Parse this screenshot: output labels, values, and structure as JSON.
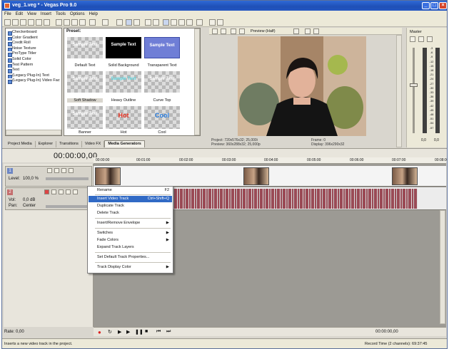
{
  "window": {
    "title": "veg_1.veg * - Vegas Pro 9.0",
    "controls": [
      "_",
      "□",
      "×"
    ]
  },
  "menu": [
    "File",
    "Edit",
    "View",
    "Insert",
    "Tools",
    "Options",
    "Help"
  ],
  "media_generators": {
    "items": [
      "Checkerboard",
      "Color Gradient",
      "Credit Roll",
      "Noise Texture",
      "ProType Titler",
      "Solid Color",
      "Test Pattern",
      "Text",
      "(Legacy Plug-In) Text",
      "(Legacy Plug-In) Video Factory"
    ],
    "selected": "Text"
  },
  "presets": {
    "label": "Preset:",
    "items": [
      {
        "name": "Default Text",
        "sample": "Sample Text",
        "style": "checker"
      },
      {
        "name": "Solid Background",
        "sample": "Sample Text",
        "style": "black"
      },
      {
        "name": "Transparent Text",
        "sample": "Sample Text",
        "style": "blue"
      },
      {
        "name": "Soft Shadow",
        "sample": "Sample Text",
        "style": "checker"
      },
      {
        "name": "Heavy Outline",
        "sample": "Sample Text",
        "style": "checker-outline"
      },
      {
        "name": "Curve Top",
        "sample": "Sample Text",
        "style": "checker"
      },
      {
        "name": "Banner",
        "sample": "Sample Text",
        "style": "checker"
      },
      {
        "name": "Hot",
        "sample": "Hot",
        "style": "hot"
      },
      {
        "name": "Cool",
        "sample": "Cool",
        "style": "cool"
      }
    ]
  },
  "tabs": [
    "Project Media",
    "Explorer",
    "Transitions",
    "Video FX",
    "Media Generators"
  ],
  "active_tab": "Media Generators",
  "preview": {
    "mode": "Preview (Half)",
    "project": "Project:  720x576x32; 25,000i",
    "preview_res": "Preview:  360x288x32; 25,000p",
    "frame": "Frame:     0",
    "display": "Display:   396x290x32"
  },
  "master": {
    "label": "Master",
    "levels": [
      "-3",
      "-6",
      "-9",
      "-12",
      "-15",
      "-18",
      "-21",
      "-24",
      "-27",
      "-30",
      "-33",
      "-36",
      "-39",
      "-42",
      "-45",
      "-48",
      "-51",
      "-54",
      "-57"
    ],
    "values": [
      "0,0",
      "0,0"
    ]
  },
  "timeline": {
    "timecode": "00:00:00,00",
    "ruler": [
      "00:00:00",
      "00:01:00",
      "00:02:00",
      "00:03:00",
      "00:04:00",
      "00:05:00",
      "00:06:00",
      "00:07:00",
      "00:08:00"
    ],
    "tracks": [
      {
        "number": "1",
        "type": "video",
        "level_label": "Level:",
        "level_value": "100,0 %"
      },
      {
        "number": "2",
        "type": "audio",
        "vol_label": "Vol:",
        "vol_value": "0,0 dB",
        "pan_label": "Pan:",
        "pan_value": "Center"
      }
    ],
    "rate": "Rate: 0,00",
    "end_time": "00:00:00,00"
  },
  "context_menu": {
    "items": [
      {
        "label": "Rename",
        "shortcut": "F2"
      },
      {
        "label": "Insert Video Track",
        "shortcut": "Ctrl+Shift+Q",
        "highlighted": true
      },
      {
        "label": "Duplicate Track"
      },
      {
        "label": "Delete Track"
      },
      {
        "label": "Insert/Remove Envelope",
        "submenu": true
      },
      {
        "label": "Switches",
        "submenu": true
      },
      {
        "label": "Fade Colors",
        "submenu": true
      },
      {
        "label": "Expand Track Layers"
      },
      {
        "label": "Set Default Track Properties..."
      },
      {
        "label": "Track Display Color",
        "submenu": true
      }
    ]
  },
  "status": {
    "message": "Inserts a new video track in the project.",
    "record_time": "Record Time (2 channels): 69:37:45"
  }
}
